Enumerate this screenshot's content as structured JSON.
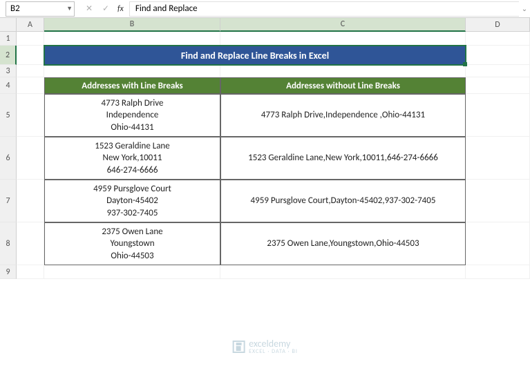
{
  "name_box": {
    "value": "B2"
  },
  "formula_bar": {
    "fx": "fx",
    "value": "Find and Replace"
  },
  "columns": [
    "A",
    "B",
    "C",
    "D"
  ],
  "rows": [
    "1",
    "2",
    "3",
    "4",
    "5",
    "6",
    "7",
    "8",
    "9"
  ],
  "title": "Find and Replace Line Breaks in Excel",
  "headers": {
    "with": "Addresses with Line Breaks",
    "without": "Addresses without Line Breaks"
  },
  "data": [
    {
      "with": "4773 Ralph Drive\nIndependence\nOhio-44131",
      "without": "4773 Ralph Drive,Independence ,Ohio-44131"
    },
    {
      "with": "1523 Geraldine Lane\nNew York,10011\n646-274-6666",
      "without": "1523 Geraldine Lane,New York,10011,646-274-6666"
    },
    {
      "with": "4959 Pursglove Court\nDayton-45402\n937-302-7405",
      "without": "4959 Pursglove Court,Dayton-45402,937-302-7405"
    },
    {
      "with": "2375 Owen Lane\nYoungstown\nOhio-44503",
      "without": "2375 Owen Lane,Youngstown,Ohio-44503"
    }
  ],
  "watermark": {
    "brand": "exceldemy",
    "sub": "EXCEL · DATA · BI"
  }
}
